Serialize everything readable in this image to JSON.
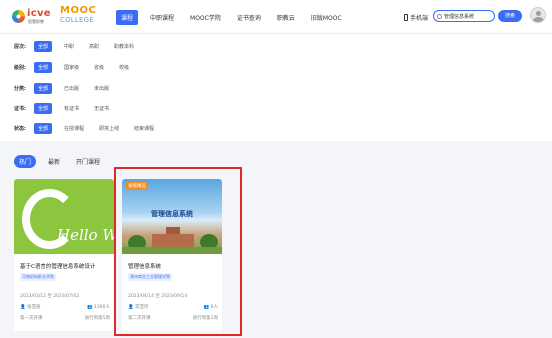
{
  "header": {
    "logo_icve": "icve",
    "logo_icve_sub": "智慧职教",
    "logo_mooc_top": "MOOC",
    "logo_mooc_bottom": "COLLEGE",
    "nav": [
      "课程",
      "中职课程",
      "MOOC学院",
      "证书查询",
      "职教云",
      "旧版MOOC"
    ],
    "nav_active_index": 0,
    "mobile_label": "手机端",
    "search_value": "管理信息系统",
    "search_button": "搜索"
  },
  "filters": [
    {
      "label": "层次:",
      "options": [
        "全部",
        "中职",
        "高职",
        "职教本科"
      ]
    },
    {
      "label": "级别:",
      "options": [
        "全部",
        "国家级",
        "省级",
        "校级"
      ]
    },
    {
      "label": "分类:",
      "options": [
        "全部",
        "已出版",
        "未出版"
      ]
    },
    {
      "label": "证书:",
      "options": [
        "全部",
        "有证书",
        "无证书"
      ]
    },
    {
      "label": "状态:",
      "options": [
        "全部",
        "在授课程",
        "即将上线",
        "结束课程"
      ]
    }
  ],
  "tabs": [
    "热门",
    "最新",
    "开门课程"
  ],
  "tabs_active_index": 0,
  "cards": [
    {
      "thumb_text": "Hello Wo",
      "title": "基于C语言的管理信息系统设计",
      "school": "河南机电职业学院",
      "dates": "2023/03/12 至 2023/07/02",
      "teacher": "张亚丽",
      "count": "1390人",
      "term": "第一次开课",
      "progress": "进行到第5周"
    },
    {
      "thumb_badge": "省级精品",
      "thumb_title": "管理信息系统",
      "title": "管理信息系统",
      "school": "郑州商业工业管理学院",
      "dates": "2023/04/14 至 2023/09/14",
      "teacher": "常亚玲",
      "count": "0人",
      "term": "第二次开课",
      "progress": "进行到第1周"
    }
  ],
  "colors": {
    "accent": "#3a6cf4",
    "highlight": "#e02a2a",
    "card_green": "#8cc63f"
  }
}
